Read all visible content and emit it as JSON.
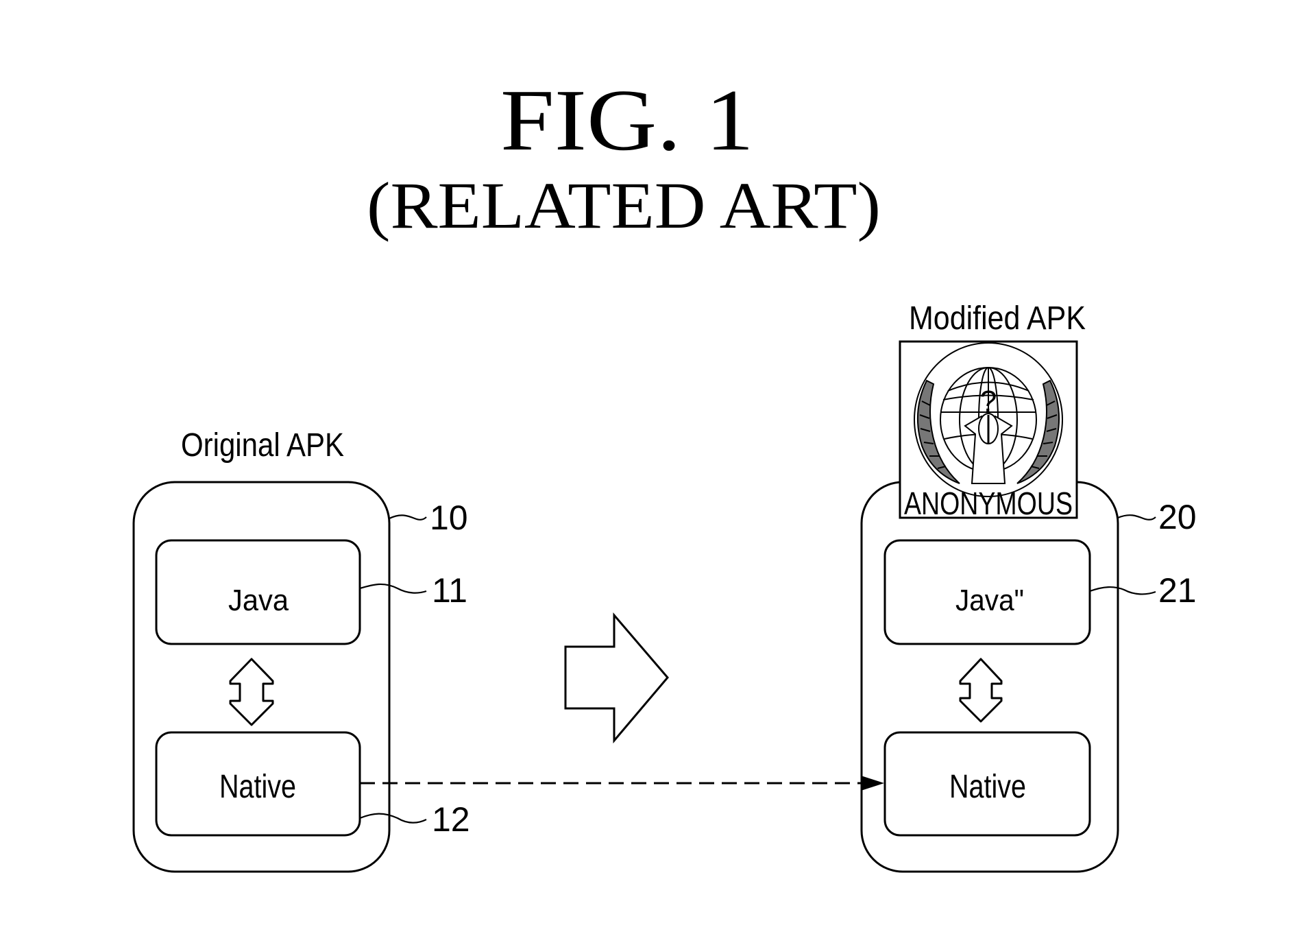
{
  "figure": {
    "title": "FIG.  1",
    "subtitle": "(RELATED ART)"
  },
  "original_apk": {
    "label": "Original APK",
    "ref": "10",
    "java": {
      "label": "Java",
      "ref": "11"
    },
    "native": {
      "label": "Native",
      "ref": "12"
    }
  },
  "modified_apk": {
    "label": "Modified APK",
    "ref": "20",
    "logo_text": "ANONYMOUS",
    "java": {
      "label": "Java\"",
      "ref": "21"
    },
    "native": {
      "label": "Native"
    }
  },
  "connections": [
    {
      "from": "original_apk.native",
      "to": "modified_apk.native",
      "style": "dashed-arrow"
    },
    {
      "from": "original_apk",
      "to": "modified_apk",
      "style": "block-arrow"
    }
  ]
}
